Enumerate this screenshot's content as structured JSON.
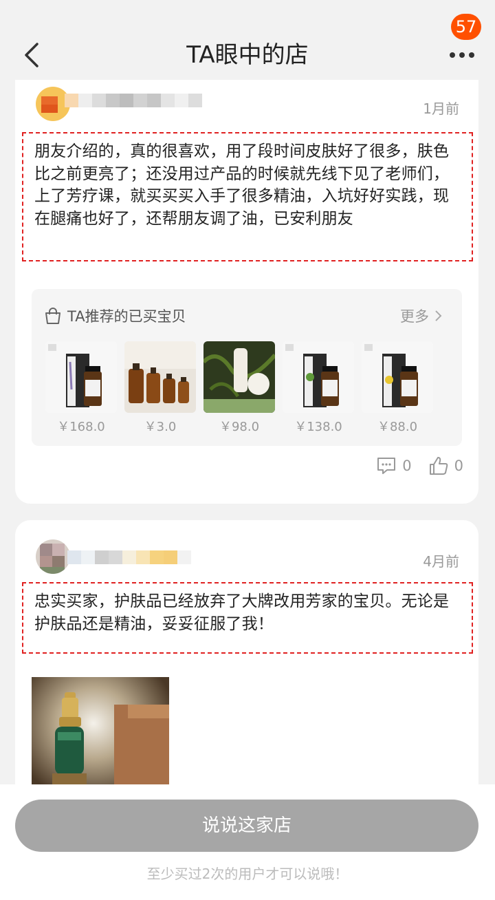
{
  "header": {
    "title": "TA眼中的店",
    "badge_count": "57"
  },
  "reviews": [
    {
      "time": "1月前",
      "content": "朋友介绍的，真的很喜欢，用了段时间皮肤好了很多，肤色比之前更亮了；还没用过产品的时候就先线下见了老师们，上了芳疗课，就买买买入手了很多精油，入坑好好实践，现在腿痛也好了，还帮朋友调了油，已安利朋友",
      "recommend": {
        "title": "TA推荐的已买宝贝",
        "more_label": "更多",
        "products": [
          {
            "price": "￥168.0"
          },
          {
            "price": "￥3.0"
          },
          {
            "price": "￥98.0"
          },
          {
            "price": "￥138.0"
          },
          {
            "price": "￥88.0"
          }
        ]
      },
      "comment_count": "0",
      "like_count": "0"
    },
    {
      "time": "4月前",
      "content": "忠实买家，护肤品已经放弃了大牌改用芳家的宝贝。无论是护肤品还是精油，妥妥征服了我！"
    }
  ],
  "footer": {
    "button_label": "说说这家店",
    "hint": "至少买过2次的用户才可以说哦！"
  },
  "colors": {
    "accent": "#ff5000",
    "dashed_border": "#e02020",
    "button_disabled": "#a6a6a6"
  }
}
